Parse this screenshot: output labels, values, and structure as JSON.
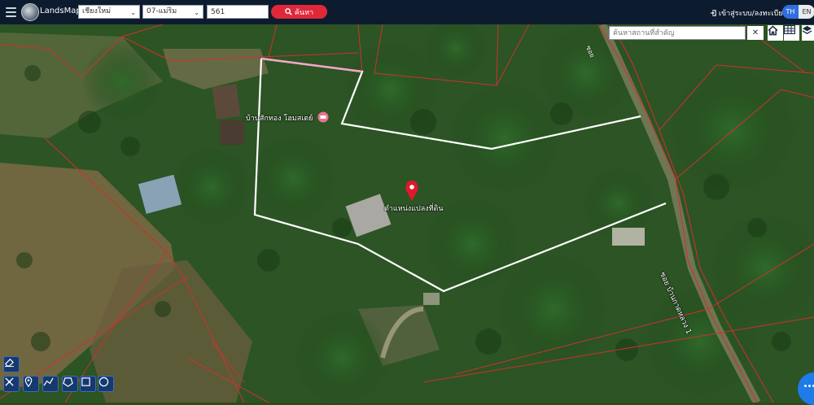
{
  "header": {
    "app_title": "LandsMaps",
    "province_select": "เชียงใหม่",
    "district_select": "07-แม่ริม",
    "parcel_number": "561",
    "search_label": "ค้นหา",
    "login_link": "เข้าสู่ระบบ/ลงทะเบียน",
    "lang_th": "TH",
    "lang_en": "EN"
  },
  "map": {
    "place_search_placeholder": "ค้นหาสถานที่สำคัญ",
    "clear_symbol": "✕",
    "labels": {
      "homestay": "บ้านสักทอง โฮมสเตย์",
      "parcel_marker": "ตำแหน่งแปลงที่ดิน",
      "road_lower": "ซอย บ้านกาดหลวง 1",
      "road_upper": "ซอย"
    }
  },
  "icons": {
    "menu": "hamburger-menu-icon",
    "logo": "landsmaps-logo",
    "search": "search-icon",
    "home": "home-icon",
    "grid": "grid-icon",
    "layers": "layers-icon",
    "eraser": "eraser-icon",
    "measure": "measure-tool-icon",
    "pin": "pin-icon",
    "polyline": "polyline-icon",
    "polygon": "polygon-icon",
    "rectangle": "rectangle-icon",
    "circle": "circle-icon",
    "chat": "chat-icon"
  },
  "colors": {
    "topbar": "#0d1b2e",
    "search_button": "#e0283a",
    "lang_active": "#2f6fde",
    "parcel_outline": "#ffffff",
    "cadastral_lines": "#d0312d",
    "marker": "#e0182d",
    "chat_button": "#1e7be8"
  }
}
